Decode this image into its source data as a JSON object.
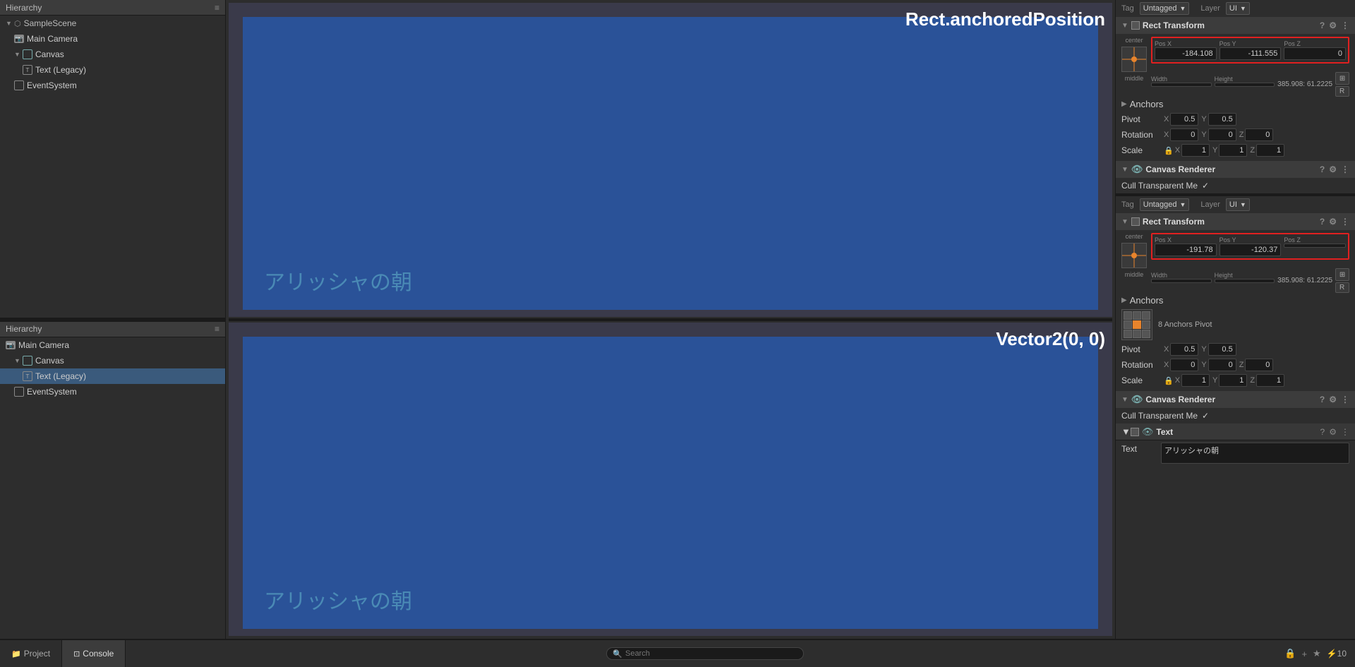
{
  "hierarchy": {
    "title": "Hierarchy",
    "top_section": {
      "items": [
        {
          "label": "SampleScene",
          "type": "scene",
          "indent": 0,
          "expanded": true
        },
        {
          "label": "Main Camera",
          "type": "camera",
          "indent": 1
        },
        {
          "label": "Canvas",
          "type": "canvas",
          "indent": 1,
          "expanded": true
        },
        {
          "label": "Text (Legacy)",
          "type": "text",
          "indent": 2
        },
        {
          "label": "EventSystem",
          "type": "event",
          "indent": 1
        }
      ]
    },
    "bottom_section": {
      "items": [
        {
          "label": "Main Camera",
          "type": "camera",
          "indent": 0
        },
        {
          "label": "Canvas",
          "type": "canvas",
          "indent": 1,
          "expanded": true
        },
        {
          "label": "Text (Legacy)",
          "type": "text",
          "indent": 2,
          "selected": true
        },
        {
          "label": "EventSystem",
          "type": "event",
          "indent": 1
        }
      ]
    }
  },
  "scene_views": {
    "top": {
      "title": "Rect.anchoredPosition",
      "jp_text": "アリッシャの朝",
      "bg_color": "#2a5298"
    },
    "bottom": {
      "title": "Vector2(0, 0)",
      "jp_text": "アリッシャの朝",
      "bg_color": "#2a5298"
    }
  },
  "inspector": {
    "top_section": {
      "tag_label": "Tag",
      "tag_value": "Untagged",
      "layer_label": "Layer",
      "layer_value": "UI",
      "rect_transform_title": "Rect Transform",
      "center_label": "center",
      "middle_label": "middle",
      "pos_x_label": "Pos X",
      "pos_x_value": "-184.108",
      "pos_y_label": "Pos Y",
      "pos_y_value": "-111.555",
      "pos_z_label": "Pos Z",
      "pos_z_value": "0",
      "width_label": "Width",
      "width_value": "385.908",
      "height_label": "Height",
      "height_value": "61.2225",
      "anchors_label": "Anchors",
      "pivot_label": "Pivot",
      "pivot_x": "0.5",
      "pivot_y": "0.5",
      "rotation_label": "Rotation",
      "rotation_x": "0",
      "rotation_y": "0",
      "rotation_z": "0",
      "scale_label": "Scale",
      "scale_x": "1",
      "scale_y": "1",
      "scale_z": "1",
      "canvas_renderer_title": "Canvas Renderer",
      "cull_label": "Cull Transparent Me",
      "cull_checked": true
    },
    "bottom_section": {
      "tag_label": "Tag",
      "tag_value": "Untagged",
      "layer_label": "Layer",
      "layer_value": "UI",
      "rect_transform_title": "Rect Transform",
      "center_label": "center",
      "middle_label": "middle",
      "pos_x_label": "Pos X",
      "pos_x_value": "-191.78",
      "pos_y_label": "Pos Y",
      "pos_y_value": "-120.37",
      "pos_z_label": "Pos Z",
      "pos_z_value": "",
      "width_label": "Width",
      "width_value": "385.908",
      "height_label": "Height",
      "height_value": "61.2225",
      "anchors_label": "Anchors",
      "pivot_label": "Pivot",
      "pivot_x": "0.5",
      "pivot_y": "0.5",
      "rotation_label": "Rotation",
      "rotation_x": "0",
      "rotation_y": "0",
      "rotation_z": "0",
      "scale_label": "Scale",
      "scale_x": "1",
      "scale_y": "1",
      "scale_z": "1",
      "canvas_renderer_title": "Canvas Renderer",
      "cull_label": "Cull Transparent Me",
      "cull_checked": true,
      "text_component_title": "Text",
      "text_label": "Text",
      "text_value": "アリッシャの朝"
    },
    "anchors_pivot_label": "8 Anchors Pivot"
  },
  "bottom_bar": {
    "project_label": "Project",
    "console_label": "Console",
    "search_placeholder": "Search"
  }
}
